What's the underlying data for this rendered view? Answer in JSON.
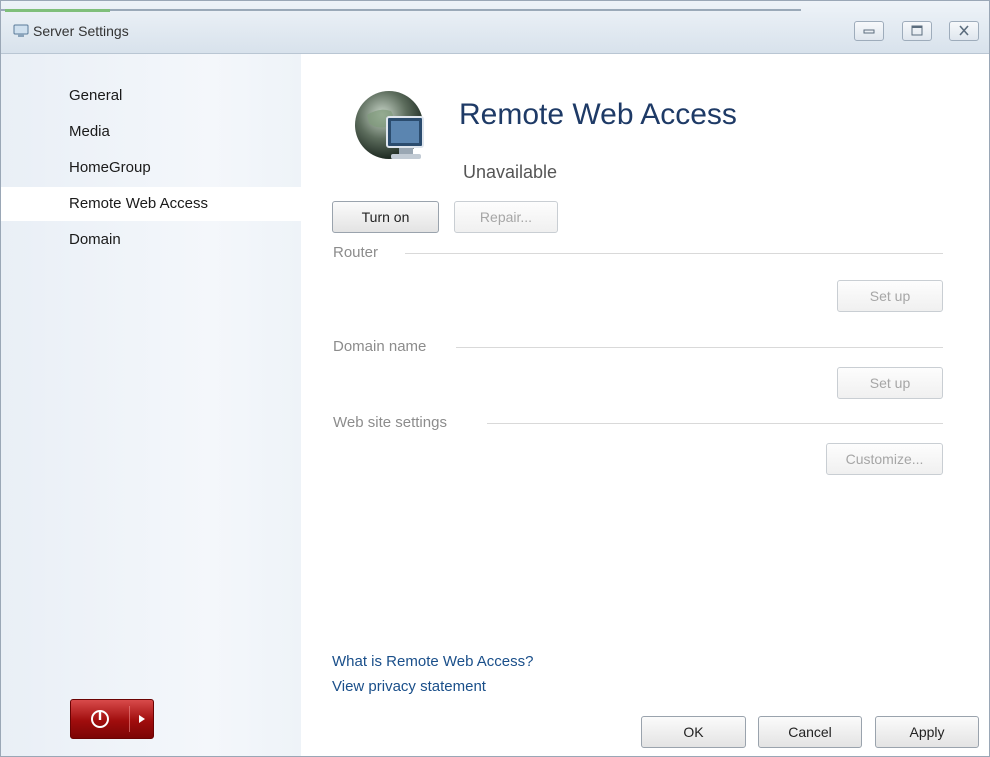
{
  "window": {
    "title": "Server Settings"
  },
  "sidebar": {
    "items": [
      {
        "label": "General"
      },
      {
        "label": "Media"
      },
      {
        "label": "HomeGroup"
      },
      {
        "label": "Remote Web Access",
        "selected": true
      },
      {
        "label": "Domain"
      }
    ]
  },
  "main": {
    "title": "Remote Web Access",
    "status": "Unavailable",
    "turn_on_label": "Turn on",
    "repair_label": "Repair...",
    "sections": [
      {
        "label": "Router",
        "button": "Set up"
      },
      {
        "label": "Domain name",
        "button": "Set up"
      },
      {
        "label": "Web site settings",
        "button": "Customize..."
      }
    ],
    "links": {
      "what_is": "What is Remote Web Access?",
      "privacy": "View privacy statement"
    }
  },
  "footer": {
    "ok": "OK",
    "cancel": "Cancel",
    "apply": "Apply"
  },
  "colors": {
    "accent": "#1e3a66",
    "link": "#1a4f8a",
    "power": "#b01010"
  }
}
